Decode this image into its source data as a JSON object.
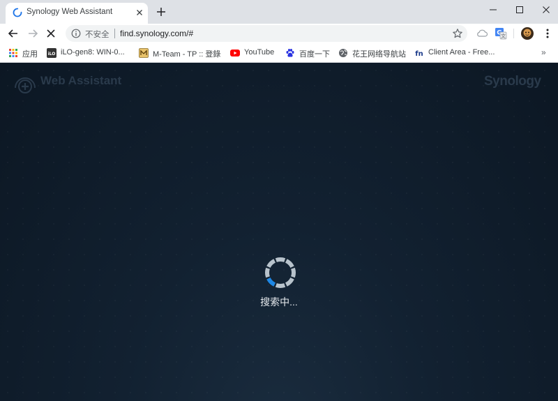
{
  "browser": {
    "tab": {
      "title": "Synology Web Assistant"
    },
    "address_bar": {
      "security_label": "不安全",
      "url": "find.synology.com/#"
    },
    "bookmarks": [
      {
        "label": "应用",
        "icon": "apps-grid-icon"
      },
      {
        "label": "iLO-gen8: WIN-0...",
        "icon": "ilo-icon"
      },
      {
        "label": "M-Team - TP :: 登錄",
        "icon": "mteam-icon"
      },
      {
        "label": "YouTube",
        "icon": "youtube-icon"
      },
      {
        "label": "百度一下",
        "icon": "baidu-paw-icon"
      },
      {
        "label": "花王网络导航站",
        "icon": "globe-icon"
      },
      {
        "label": "Client Area - Free...",
        "icon": "fn-icon"
      }
    ]
  },
  "page": {
    "logo_text": "Web Assistant",
    "brand": "Synology",
    "status_text": "搜索中..."
  },
  "colors": {
    "page_bg": "#0f1b29",
    "spinner_ring": "#b8c3cc",
    "spinner_accent": "#1e88e5",
    "status_text": "#e6eaee"
  }
}
